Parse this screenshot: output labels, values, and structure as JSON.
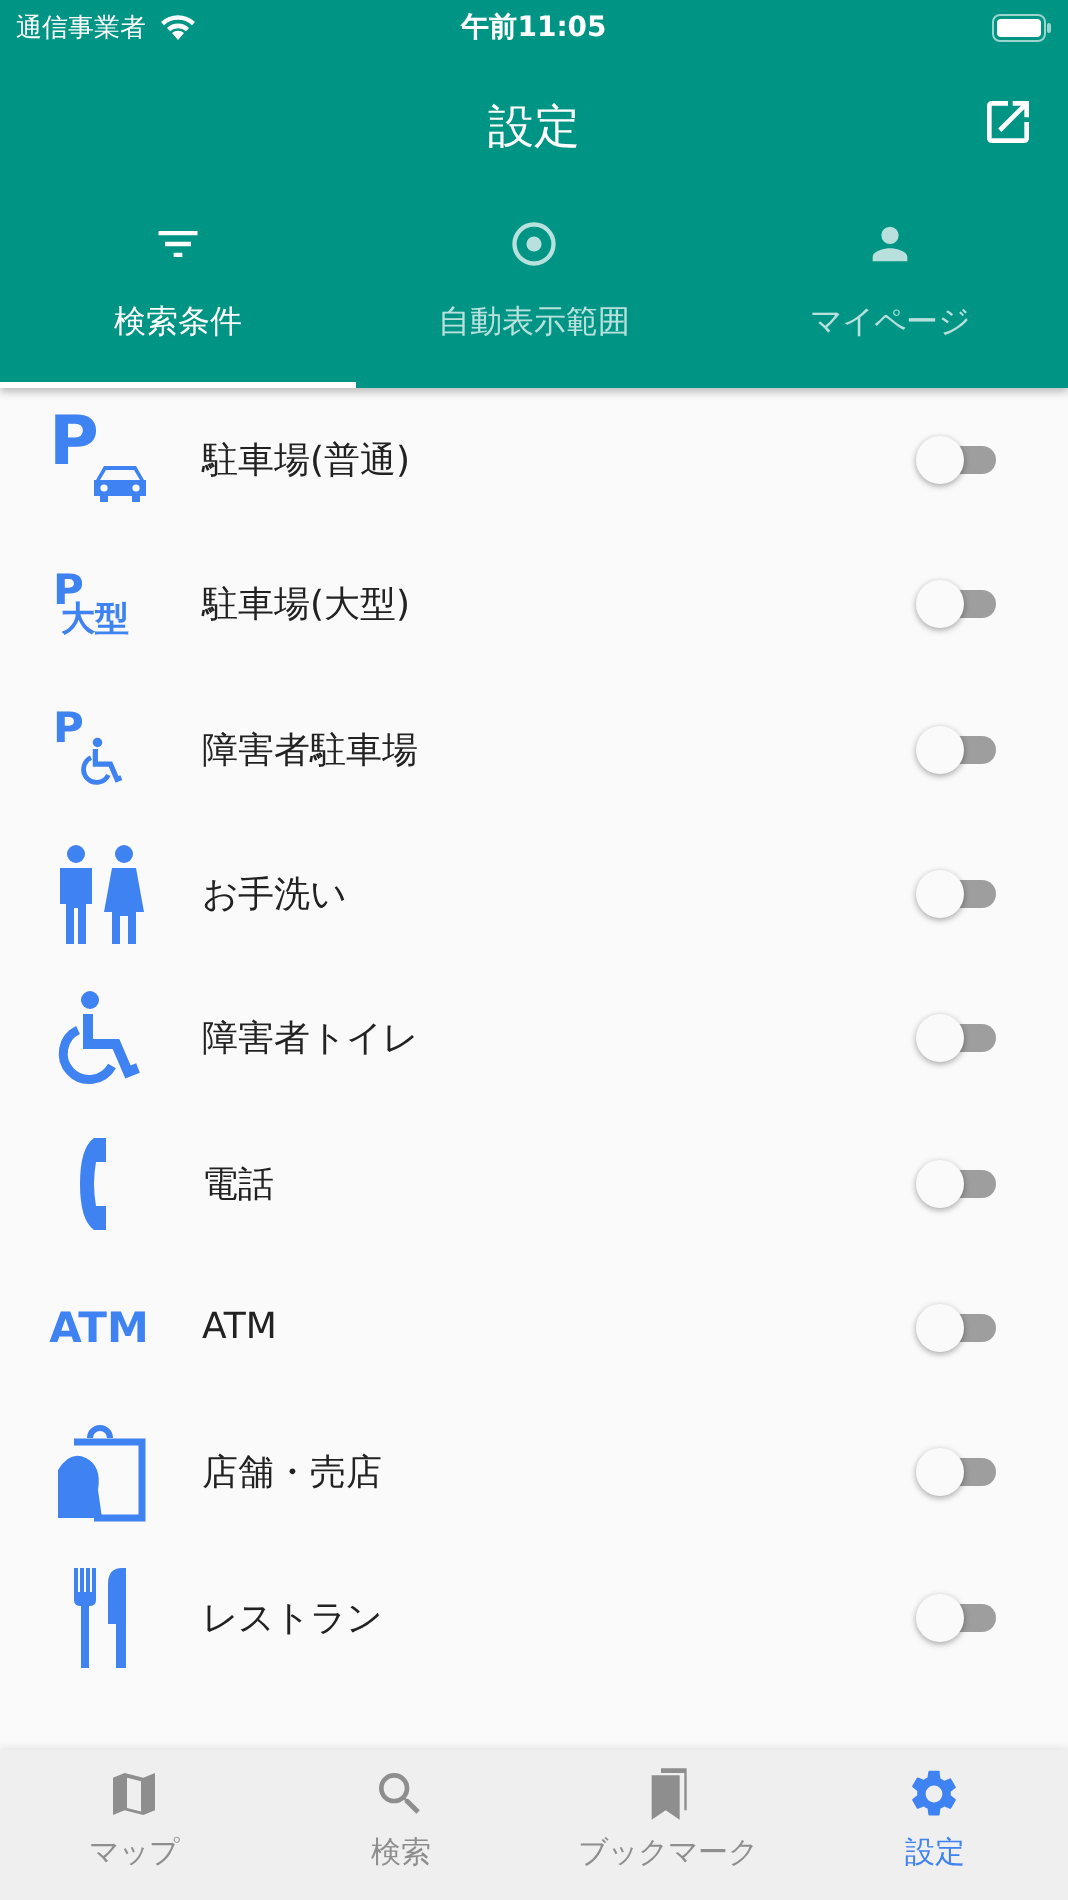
{
  "status_bar": {
    "carrier": "通信事業者",
    "time": "午前11:05"
  },
  "header": {
    "title": "設定"
  },
  "tabs": [
    {
      "label": "検索条件",
      "kind": "filter",
      "selected": true
    },
    {
      "label": "自動表示範囲",
      "kind": "target",
      "selected": false
    },
    {
      "label": "マイページ",
      "kind": "person",
      "selected": false
    }
  ],
  "items": [
    {
      "kind": "parking-car",
      "icon_text": "P",
      "label": "駐車場(普通)",
      "on": false
    },
    {
      "kind": "parking-large",
      "icon_text": "P",
      "icon_subtext": "大型",
      "label": "駐車場(大型)",
      "on": false
    },
    {
      "kind": "parking-wheelchair",
      "icon_text": "P",
      "label": "障害者駐車場",
      "on": false
    },
    {
      "kind": "restroom",
      "label": "お手洗い",
      "on": false
    },
    {
      "kind": "wheelchair",
      "label": "障害者トイレ",
      "on": false
    },
    {
      "kind": "phone",
      "label": "電話",
      "on": false
    },
    {
      "kind": "atm",
      "icon_text": "ATM",
      "label": "ATM",
      "on": false
    },
    {
      "kind": "shop",
      "label": "店舗・売店",
      "on": false
    },
    {
      "kind": "restaurant",
      "label": "レストラン",
      "on": false
    }
  ],
  "bottom_nav": [
    {
      "label": "マップ",
      "kind": "map",
      "selected": false
    },
    {
      "label": "検索",
      "kind": "search",
      "selected": false
    },
    {
      "label": "ブックマーク",
      "kind": "bookmark",
      "selected": false
    },
    {
      "label": "設定",
      "kind": "settings",
      "selected": true
    }
  ]
}
